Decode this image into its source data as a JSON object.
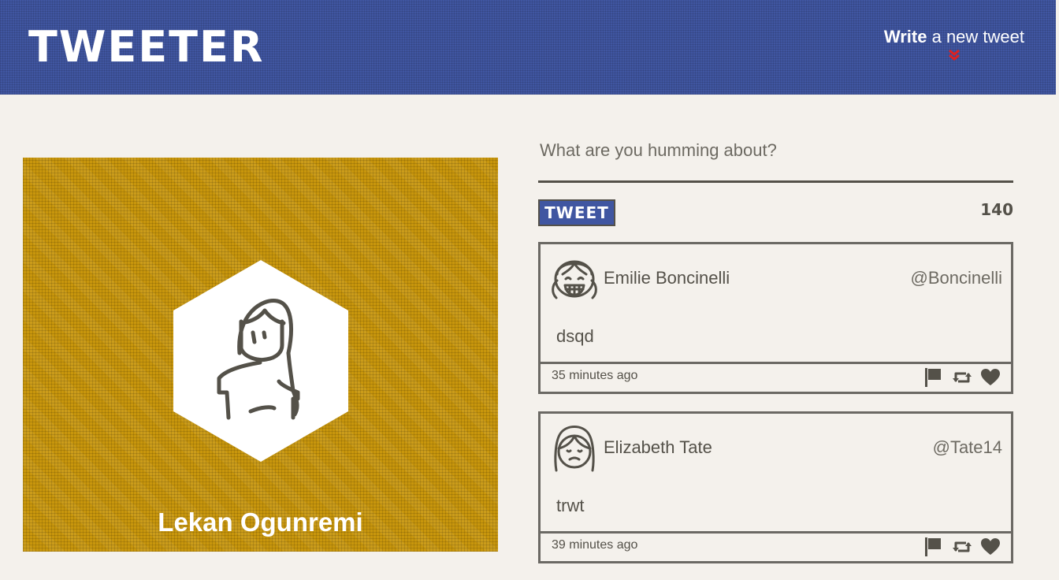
{
  "header": {
    "brand": "TWEETER",
    "compose_bold": "Write",
    "compose_rest": " a new tweet",
    "compose_icon": "double-chevron-down-icon"
  },
  "profile": {
    "name": "Lekan Ogunremi",
    "avatar_icon": "user-avatar-icon"
  },
  "composer": {
    "placeholder": "What are you humming about?",
    "button_label": "TWEET",
    "counter": "140"
  },
  "tweets": [
    {
      "name": "Emilie Boncinelli",
      "handle": "@Boncinelli",
      "content": "dsqd",
      "time": "35 minutes ago"
    },
    {
      "name": "Elizabeth Tate",
      "handle": "@Tate14",
      "content": "trwt",
      "time": "39 minutes ago"
    }
  ],
  "colors": {
    "nav": "#4056a1",
    "profile_bg": "#c8960c",
    "page_bg": "#f4f1ec",
    "text": "#545149",
    "accent_red": "#e02020"
  }
}
